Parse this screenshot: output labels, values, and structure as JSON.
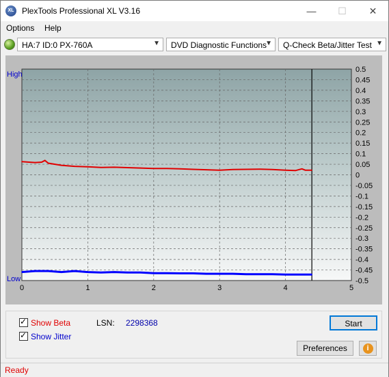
{
  "window": {
    "title": "PlexTools Professional XL V3.16",
    "icon_text": "XL"
  },
  "menu": {
    "items": [
      {
        "label": "Options"
      },
      {
        "label": "Help"
      }
    ]
  },
  "toolbar": {
    "drive": "HA:7 ID:0  PX-760A",
    "function": "DVD Diagnostic Functions",
    "test": "Q-Check Beta/Jitter Test"
  },
  "chart_data": {
    "type": "line",
    "left_labels": {
      "high": "High",
      "low": "Low"
    },
    "x_ticks": [
      "0",
      "1",
      "2",
      "3",
      "4",
      "5"
    ],
    "y_right_ticks": [
      "0.5",
      "0.45",
      "0.4",
      "0.35",
      "0.3",
      "0.25",
      "0.2",
      "0.15",
      "0.1",
      "0.05",
      "0",
      "-0.05",
      "-0.1",
      "-0.15",
      "-0.2",
      "-0.25",
      "-0.3",
      "-0.35",
      "-0.4",
      "-0.45",
      "-0.5"
    ],
    "xlim": [
      0,
      5
    ],
    "ylim": [
      -0.5,
      0.5
    ],
    "end_marker_x": 4.4,
    "series": [
      {
        "color": "#e00000",
        "points": [
          [
            0,
            0.062
          ],
          [
            0.2,
            0.058
          ],
          [
            0.3,
            0.06
          ],
          [
            0.35,
            0.068
          ],
          [
            0.4,
            0.055
          ],
          [
            0.6,
            0.045
          ],
          [
            0.8,
            0.04
          ],
          [
            1.0,
            0.038
          ],
          [
            1.2,
            0.035
          ],
          [
            1.4,
            0.036
          ],
          [
            1.6,
            0.034
          ],
          [
            1.8,
            0.032
          ],
          [
            2.0,
            0.03
          ],
          [
            2.2,
            0.03
          ],
          [
            2.4,
            0.028
          ],
          [
            2.6,
            0.026
          ],
          [
            2.8,
            0.024
          ],
          [
            3.0,
            0.022
          ],
          [
            3.2,
            0.025
          ],
          [
            3.4,
            0.026
          ],
          [
            3.6,
            0.027
          ],
          [
            3.8,
            0.025
          ],
          [
            4.0,
            0.022
          ],
          [
            4.15,
            0.02
          ],
          [
            4.25,
            0.028
          ],
          [
            4.3,
            0.022
          ],
          [
            4.4,
            0.022
          ]
        ]
      },
      {
        "color": "#0000ff",
        "points": [
          [
            0,
            -0.46
          ],
          [
            0.2,
            -0.455
          ],
          [
            0.4,
            -0.455
          ],
          [
            0.6,
            -0.46
          ],
          [
            0.8,
            -0.455
          ],
          [
            1.0,
            -0.46
          ],
          [
            1.2,
            -0.462
          ],
          [
            1.4,
            -0.46
          ],
          [
            1.6,
            -0.462
          ],
          [
            1.8,
            -0.462
          ],
          [
            2.0,
            -0.465
          ],
          [
            2.2,
            -0.465
          ],
          [
            2.4,
            -0.466
          ],
          [
            2.6,
            -0.466
          ],
          [
            2.8,
            -0.468
          ],
          [
            3.0,
            -0.468
          ],
          [
            3.2,
            -0.468
          ],
          [
            3.4,
            -0.47
          ],
          [
            3.6,
            -0.47
          ],
          [
            3.8,
            -0.47
          ],
          [
            4.0,
            -0.472
          ],
          [
            4.2,
            -0.472
          ],
          [
            4.4,
            -0.472
          ]
        ]
      }
    ]
  },
  "controls": {
    "show_beta": "Show Beta",
    "show_jitter": "Show Jitter",
    "lsn_label": "LSN:",
    "lsn_value": "2298368",
    "start": "Start",
    "preferences": "Preferences"
  },
  "status": {
    "text": "Ready"
  },
  "colors": {
    "beta": "#e00000",
    "jitter": "#0000ff"
  }
}
